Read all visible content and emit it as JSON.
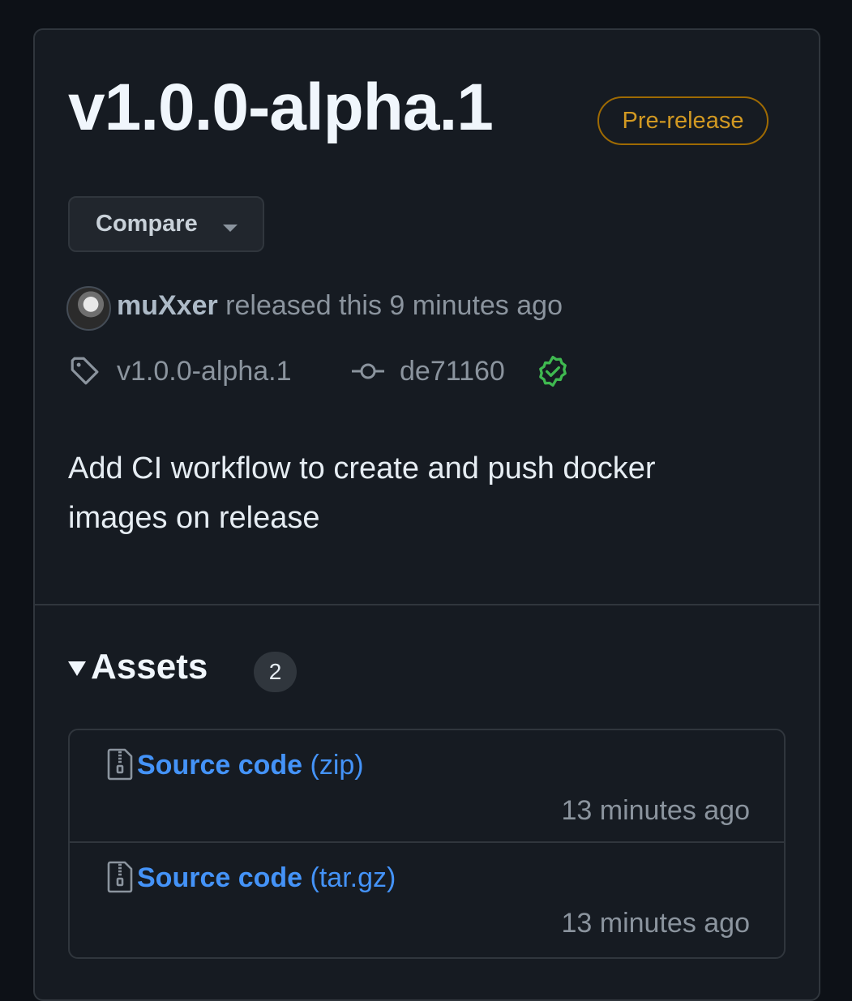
{
  "release": {
    "title": "v1.0.0-alpha.1",
    "badge": "Pre-release",
    "compare_label": "Compare",
    "author": "muXxer",
    "released_text": " released this 9 minutes ago",
    "tag": "v1.0.0-alpha.1",
    "commit": "de71160",
    "notes": "Add CI workflow to create and push docker images on release"
  },
  "assets": {
    "heading": "Assets",
    "count": "2",
    "items": [
      {
        "name": "Source code",
        "format": " (zip)",
        "time": "13 minutes ago"
      },
      {
        "name": "Source code",
        "format": " (tar.gz)",
        "time": "13 minutes ago"
      }
    ]
  },
  "colors": {
    "background": "#161b22",
    "prerelease": "#d29922",
    "link": "#4493f8",
    "verified": "#3fb950"
  },
  "icons": [
    "tag-icon",
    "git-commit-icon",
    "verified-icon",
    "file-zip-icon",
    "chevron-down-icon",
    "triangle-down-icon"
  ]
}
